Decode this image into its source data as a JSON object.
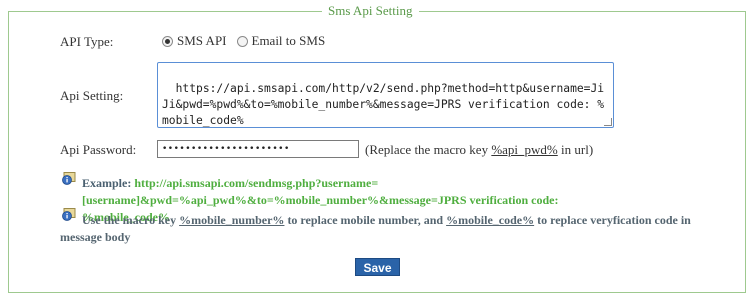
{
  "section_title": "Sms Api Setting",
  "api_type": {
    "label": "API Type:",
    "options": [
      {
        "label": "SMS API",
        "selected": true
      },
      {
        "label": "Email to SMS",
        "selected": false
      }
    ]
  },
  "api_setting": {
    "label": "Api Setting:",
    "value": "https://api.smsapi.com/http/v2/send.php?method=http&username=JiJi&pwd=%pwd%&to=%mobile_number%&message=JPRS verification code: %mobile_code%"
  },
  "api_password": {
    "label": "Api Password:",
    "masked_value": "••••••••••••••••••••••",
    "note_prefix": "(Replace the macro key ",
    "note_macro": "%api_pwd%",
    "note_suffix": " in url)"
  },
  "example": {
    "label": "Example: ",
    "text": "http://api.smsapi.com/sendmsg.php?username=[username]&pwd=%api_pwd%&to=%mobile_number%&message=JPRS verification code: %mobile_code%"
  },
  "usage": {
    "prefix": "Use the macro key ",
    "macro1": "%mobile_number%",
    "middle": " to replace mobile number, and ",
    "macro2": "%mobile_code%",
    "suffix": " to replace veryfication code in message body"
  },
  "save_label": "Save",
  "icons": {
    "info": "info-icon"
  },
  "colors": {
    "border": "#9ec98f",
    "legend": "#5a9a4a",
    "example": "#4fae3f",
    "button": "#2a63a8"
  }
}
